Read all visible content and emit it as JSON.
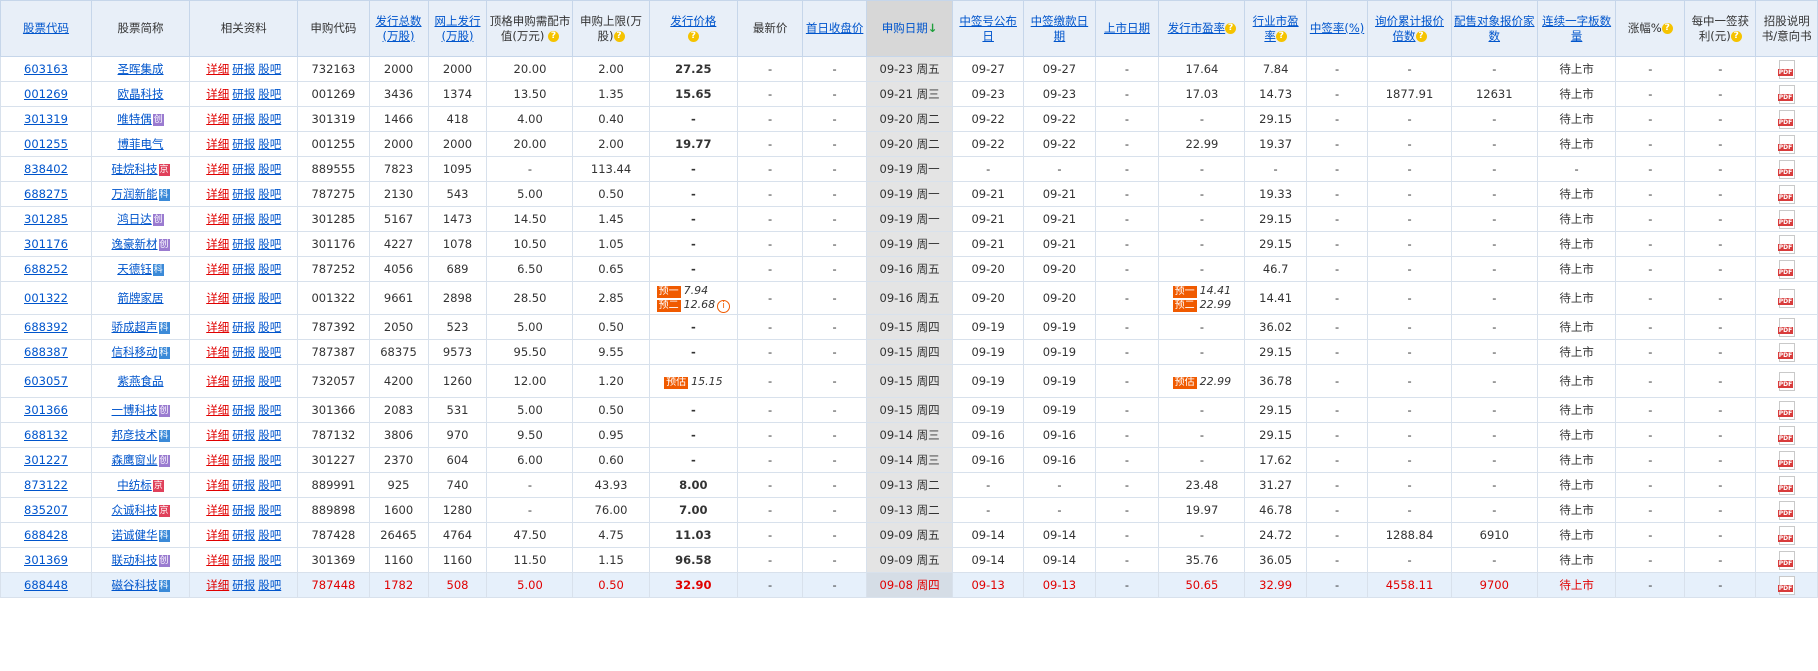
{
  "headers": [
    "股票代码",
    "股票简称",
    "相关资料",
    "申购代码",
    "发行总数(万股)",
    "网上发行(万股)",
    "顶格申购需配市值(万元)",
    "申购上限(万股)",
    "发行价格",
    "最新价",
    "首日收盘价",
    "申购日期",
    "中签号公布日",
    "中签缴款日期",
    "上市日期",
    "发行市盈率",
    "行业市盈率",
    "中签率(%)",
    "询价累计报价倍数",
    "配售对象报价家数",
    "连续一字板数量",
    "涨幅%",
    "每中一签获利(元)",
    "招股说明书/意向书"
  ],
  "link_labels": {
    "detail": "详细",
    "report": "研报",
    "bar": "股吧"
  },
  "rows": [
    {
      "code": "603163",
      "name": "圣晖集成",
      "mark": "",
      "sub": "732163",
      "total": "2000",
      "online": "2000",
      "cap": "20.00",
      "limit": "2.00",
      "price": "27.25",
      "latest": "-",
      "first": "-",
      "date": "09-23 周五",
      "pub": "09-27",
      "pay": "09-27",
      "list": "-",
      "pe": "17.64",
      "ipe": "7.84",
      "rate": "-",
      "mult": "-",
      "cnt": "-",
      "board": "待上市",
      "chg": "-",
      "profit": "-"
    },
    {
      "code": "001269",
      "name": "欧晶科技",
      "mark": "",
      "sub": "001269",
      "total": "3436",
      "online": "1374",
      "cap": "13.50",
      "limit": "1.35",
      "price": "15.65",
      "latest": "-",
      "first": "-",
      "date": "09-21 周三",
      "pub": "09-23",
      "pay": "09-23",
      "list": "-",
      "pe": "17.03",
      "ipe": "14.73",
      "rate": "-",
      "mult": "1877.91",
      "cnt": "12631",
      "board": "待上市",
      "chg": "-",
      "profit": "-"
    },
    {
      "code": "301319",
      "name": "唯特偶",
      "mark": "创",
      "sub": "301319",
      "total": "1466",
      "online": "418",
      "cap": "4.00",
      "limit": "0.40",
      "price": "-",
      "latest": "-",
      "first": "-",
      "date": "09-20 周二",
      "pub": "09-22",
      "pay": "09-22",
      "list": "-",
      "pe": "-",
      "ipe": "29.15",
      "rate": "-",
      "mult": "-",
      "cnt": "-",
      "board": "待上市",
      "chg": "-",
      "profit": "-"
    },
    {
      "code": "001255",
      "name": "博菲电气",
      "mark": "",
      "sub": "001255",
      "total": "2000",
      "online": "2000",
      "cap": "20.00",
      "limit": "2.00",
      "price": "19.77",
      "latest": "-",
      "first": "-",
      "date": "09-20 周二",
      "pub": "09-22",
      "pay": "09-22",
      "list": "-",
      "pe": "22.99",
      "ipe": "19.37",
      "rate": "-",
      "mult": "-",
      "cnt": "-",
      "board": "待上市",
      "chg": "-",
      "profit": "-"
    },
    {
      "code": "838402",
      "name": "硅烷科技",
      "mark": "京",
      "sub": "889555",
      "total": "7823",
      "online": "1095",
      "cap": "-",
      "limit": "113.44",
      "price": "-",
      "latest": "-",
      "first": "-",
      "date": "09-19 周一",
      "pub": "-",
      "pay": "-",
      "list": "-",
      "pe": "-",
      "ipe": "-",
      "rate": "-",
      "mult": "-",
      "cnt": "-",
      "board": "-",
      "chg": "-",
      "profit": "-"
    },
    {
      "code": "688275",
      "name": "万润新能",
      "mark": "科",
      "sub": "787275",
      "total": "2130",
      "online": "543",
      "cap": "5.00",
      "limit": "0.50",
      "price": "-",
      "latest": "-",
      "first": "-",
      "date": "09-19 周一",
      "pub": "09-21",
      "pay": "09-21",
      "list": "-",
      "pe": "-",
      "ipe": "19.33",
      "rate": "-",
      "mult": "-",
      "cnt": "-",
      "board": "待上市",
      "chg": "-",
      "profit": "-"
    },
    {
      "code": "301285",
      "name": "鸿日达",
      "mark": "创",
      "sub": "301285",
      "total": "5167",
      "online": "1473",
      "cap": "14.50",
      "limit": "1.45",
      "price": "-",
      "latest": "-",
      "first": "-",
      "date": "09-19 周一",
      "pub": "09-21",
      "pay": "09-21",
      "list": "-",
      "pe": "-",
      "ipe": "29.15",
      "rate": "-",
      "mult": "-",
      "cnt": "-",
      "board": "待上市",
      "chg": "-",
      "profit": "-"
    },
    {
      "code": "301176",
      "name": "逸豪新材",
      "mark": "创",
      "sub": "301176",
      "total": "4227",
      "online": "1078",
      "cap": "10.50",
      "limit": "1.05",
      "price": "-",
      "latest": "-",
      "first": "-",
      "date": "09-19 周一",
      "pub": "09-21",
      "pay": "09-21",
      "list": "-",
      "pe": "-",
      "ipe": "29.15",
      "rate": "-",
      "mult": "-",
      "cnt": "-",
      "board": "待上市",
      "chg": "-",
      "profit": "-"
    },
    {
      "code": "688252",
      "name": "天德钰",
      "mark": "科",
      "sub": "787252",
      "total": "4056",
      "online": "689",
      "cap": "6.50",
      "limit": "0.65",
      "price": "-",
      "latest": "-",
      "first": "-",
      "date": "09-16 周五",
      "pub": "09-20",
      "pay": "09-20",
      "list": "-",
      "pe": "-",
      "ipe": "46.7",
      "rate": "-",
      "mult": "-",
      "cnt": "-",
      "board": "待上市",
      "chg": "-",
      "profit": "-"
    },
    {
      "code": "001322",
      "name": "箭牌家居",
      "mark": "",
      "sub": "001322",
      "total": "9661",
      "online": "2898",
      "cap": "28.50",
      "limit": "2.85",
      "price": "",
      "price_est": [
        [
          "预一",
          "7.94"
        ],
        [
          "预二",
          "12.68"
        ]
      ],
      "latest": "-",
      "first": "-",
      "date": "09-16 周五",
      "pub": "09-20",
      "pay": "09-20",
      "list": "-",
      "pe": "",
      "pe_est": [
        [
          "预一",
          "14.41"
        ],
        [
          "预二",
          "22.99"
        ]
      ],
      "ipe": "14.41",
      "rate": "-",
      "mult": "-",
      "cnt": "-",
      "board": "待上市",
      "chg": "-",
      "profit": "-"
    },
    {
      "code": "688392",
      "name": "骄成超声",
      "mark": "科",
      "sub": "787392",
      "total": "2050",
      "online": "523",
      "cap": "5.00",
      "limit": "0.50",
      "price": "-",
      "latest": "-",
      "first": "-",
      "date": "09-15 周四",
      "pub": "09-19",
      "pay": "09-19",
      "list": "-",
      "pe": "-",
      "ipe": "36.02",
      "rate": "-",
      "mult": "-",
      "cnt": "-",
      "board": "待上市",
      "chg": "-",
      "profit": "-"
    },
    {
      "code": "688387",
      "name": "信科移动",
      "mark": "科",
      "sub": "787387",
      "total": "68375",
      "online": "9573",
      "cap": "95.50",
      "limit": "9.55",
      "price": "-",
      "latest": "-",
      "first": "-",
      "date": "09-15 周四",
      "pub": "09-19",
      "pay": "09-19",
      "list": "-",
      "pe": "-",
      "ipe": "29.15",
      "rate": "-",
      "mult": "-",
      "cnt": "-",
      "board": "待上市",
      "chg": "-",
      "profit": "-"
    },
    {
      "code": "603057",
      "name": "紫燕食品",
      "mark": "",
      "sub": "732057",
      "total": "4200",
      "online": "1260",
      "cap": "12.00",
      "limit": "1.20",
      "price": "",
      "price_est": [
        [
          "预估",
          "15.15"
        ]
      ],
      "latest": "-",
      "first": "-",
      "date": "09-15 周四",
      "pub": "09-19",
      "pay": "09-19",
      "list": "-",
      "pe": "",
      "pe_est": [
        [
          "预估",
          "22.99"
        ]
      ],
      "ipe": "36.78",
      "rate": "-",
      "mult": "-",
      "cnt": "-",
      "board": "待上市",
      "chg": "-",
      "profit": "-"
    },
    {
      "code": "301366",
      "name": "一博科技",
      "mark": "创",
      "sub": "301366",
      "total": "2083",
      "online": "531",
      "cap": "5.00",
      "limit": "0.50",
      "price": "-",
      "latest": "-",
      "first": "-",
      "date": "09-15 周四",
      "pub": "09-19",
      "pay": "09-19",
      "list": "-",
      "pe": "-",
      "ipe": "29.15",
      "rate": "-",
      "mult": "-",
      "cnt": "-",
      "board": "待上市",
      "chg": "-",
      "profit": "-"
    },
    {
      "code": "688132",
      "name": "邦彦技术",
      "mark": "科",
      "sub": "787132",
      "total": "3806",
      "online": "970",
      "cap": "9.50",
      "limit": "0.95",
      "price": "-",
      "latest": "-",
      "first": "-",
      "date": "09-14 周三",
      "pub": "09-16",
      "pay": "09-16",
      "list": "-",
      "pe": "-",
      "ipe": "29.15",
      "rate": "-",
      "mult": "-",
      "cnt": "-",
      "board": "待上市",
      "chg": "-",
      "profit": "-"
    },
    {
      "code": "301227",
      "name": "森鹰窗业",
      "mark": "创",
      "sub": "301227",
      "total": "2370",
      "online": "604",
      "cap": "6.00",
      "limit": "0.60",
      "price": "-",
      "latest": "-",
      "first": "-",
      "date": "09-14 周三",
      "pub": "09-16",
      "pay": "09-16",
      "list": "-",
      "pe": "-",
      "ipe": "17.62",
      "rate": "-",
      "mult": "-",
      "cnt": "-",
      "board": "待上市",
      "chg": "-",
      "profit": "-"
    },
    {
      "code": "873122",
      "name": "中纺标",
      "mark": "京",
      "sub": "889991",
      "total": "925",
      "online": "740",
      "cap": "-",
      "limit": "43.93",
      "price": "8.00",
      "latest": "-",
      "first": "-",
      "date": "09-13 周二",
      "pub": "-",
      "pay": "-",
      "list": "-",
      "pe": "23.48",
      "ipe": "31.27",
      "rate": "-",
      "mult": "-",
      "cnt": "-",
      "board": "待上市",
      "chg": "-",
      "profit": "-"
    },
    {
      "code": "835207",
      "name": "众诚科技",
      "mark": "京",
      "sub": "889898",
      "total": "1600",
      "online": "1280",
      "cap": "-",
      "limit": "76.00",
      "price": "7.00",
      "latest": "-",
      "first": "-",
      "date": "09-13 周二",
      "pub": "-",
      "pay": "-",
      "list": "-",
      "pe": "19.97",
      "ipe": "46.78",
      "rate": "-",
      "mult": "-",
      "cnt": "-",
      "board": "待上市",
      "chg": "-",
      "profit": "-"
    },
    {
      "code": "688428",
      "name": "诺诚健华",
      "mark": "科",
      "sub": "787428",
      "total": "26465",
      "online": "4764",
      "cap": "47.50",
      "limit": "4.75",
      "price": "11.03",
      "latest": "-",
      "first": "-",
      "date": "09-09 周五",
      "pub": "09-14",
      "pay": "09-14",
      "list": "-",
      "pe": "-",
      "ipe": "24.72",
      "rate": "-",
      "mult": "1288.84",
      "cnt": "6910",
      "board": "待上市",
      "chg": "-",
      "profit": "-"
    },
    {
      "code": "301369",
      "name": "联动科技",
      "mark": "创",
      "sub": "301369",
      "total": "1160",
      "online": "1160",
      "cap": "11.50",
      "limit": "1.15",
      "price": "96.58",
      "latest": "-",
      "first": "-",
      "date": "09-09 周五",
      "pub": "09-14",
      "pay": "09-14",
      "list": "-",
      "pe": "35.76",
      "ipe": "36.05",
      "rate": "-",
      "mult": "-",
      "cnt": "-",
      "board": "待上市",
      "chg": "-",
      "profit": "-"
    },
    {
      "code": "688448",
      "name": "磁谷科技",
      "mark": "科",
      "sub": "787448",
      "total": "1782",
      "online": "508",
      "cap": "5.00",
      "limit": "0.50",
      "price": "32.90",
      "latest": "-",
      "first": "-",
      "date": "09-08 周四",
      "pub": "09-13",
      "pay": "09-13",
      "list": "-",
      "pe": "50.65",
      "ipe": "32.99",
      "rate": "-",
      "mult": "4558.11",
      "cnt": "9700",
      "board": "待上市",
      "chg": "-",
      "profit": "-"
    }
  ]
}
